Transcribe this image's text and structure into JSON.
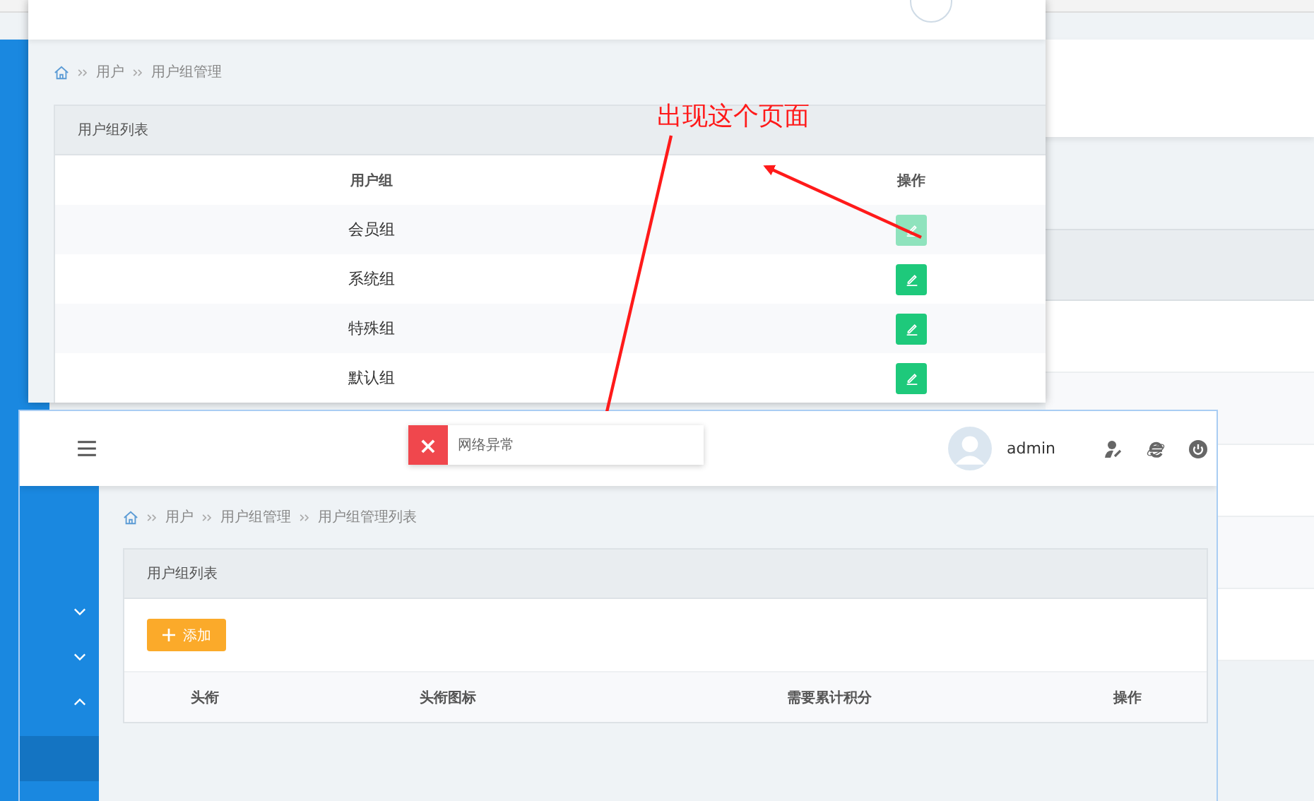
{
  "top_window": {
    "breadcrumb": [
      "用户",
      "用户组管理"
    ],
    "panel_title": "用户组列表",
    "columns": [
      "用户组",
      "操作"
    ],
    "rows": [
      {
        "name": "会员组",
        "disabled": true
      },
      {
        "name": "系统组",
        "disabled": false
      },
      {
        "name": "特殊组",
        "disabled": false
      },
      {
        "name": "默认组",
        "disabled": false
      }
    ]
  },
  "bottom_window": {
    "toast": {
      "icon": "×",
      "message": "网络异常"
    },
    "user": "admin",
    "sidebar": [
      {
        "expanded": false
      },
      {
        "expanded": false
      },
      {
        "expanded": true
      }
    ],
    "breadcrumb": [
      "用户",
      "用户组管理",
      "用户组管理列表"
    ],
    "panel_title": "用户组列表",
    "add_button": "添加",
    "columns": [
      "头衔",
      "头衔图标",
      "需要累计积分",
      "操作"
    ]
  },
  "annotation": {
    "text": "出现这个页面"
  }
}
